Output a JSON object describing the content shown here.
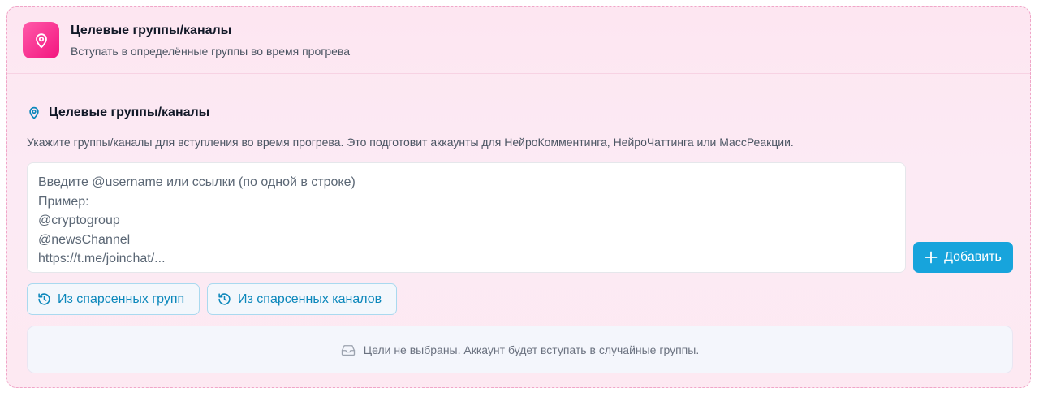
{
  "header": {
    "title": "Целевые группы/каналы",
    "subtitle": "Вступать в определённые группы во время прогрева",
    "icon": "map-pin-icon",
    "accent": "#f3157f"
  },
  "section": {
    "title": "Целевые группы/каналы",
    "icon": "map-pin-icon",
    "description": "Укажите группы/каналы для вступления во время прогрева. Это подготовит аккаунты для НейроКомментинга, НейроЧаттинга или МассРеакции."
  },
  "input": {
    "value": "",
    "placeholder": "Введите @username или ссылки (по одной в строке)\nПример:\n@cryptogroup\n@newsChannel\nhttps://t.me/joinchat/..."
  },
  "buttons": {
    "add_label": "Добавить",
    "from_groups_label": "Из спарсенных групп",
    "from_channels_label": "Из спарсенных каналов",
    "add_color": "#17a4dc"
  },
  "empty_state": {
    "text": "Цели не выбраны. Аккаунт будет вступать в случайные группы.",
    "icon": "inbox-icon"
  }
}
